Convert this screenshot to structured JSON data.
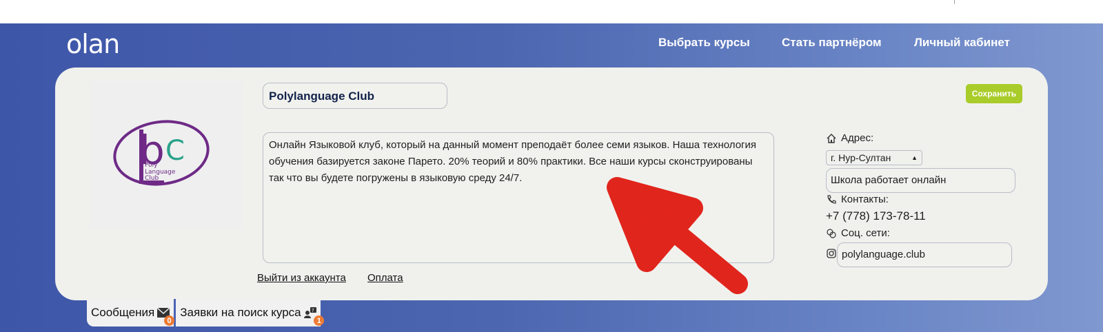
{
  "header": {
    "logo_text": "olan",
    "nav": [
      "Выбрать курсы",
      "Стать партнёром",
      "Личный кабинет"
    ]
  },
  "profile": {
    "school_name": "Polylanguage Club",
    "description": "Онлайн Языковой клуб, который на данный момент преподаёт более семи языков. Наша технология обучения базируется законе Парето. 20% теорий и 80% практики. Все наши курсы сконструированы так что вы будете погружены в языковую среду 24/7.",
    "logo_letters": "pC",
    "logo_caption": [
      "Poly",
      "Language",
      "Club"
    ],
    "save_label": "Сохранить",
    "logout_label": "Выйти из аккаунта",
    "payment_label": "Оплата"
  },
  "sidebar": {
    "address_label": "Адрес:",
    "city": "г. Нур-Султан",
    "online_text": "Школа работает онлайн",
    "contacts_label": "Контакты:",
    "phone": "+7 (778) 173-78-11",
    "social_label": "Соц. сети:",
    "instagram": "polylanguage.club"
  },
  "tabs": {
    "messages_label": "Сообщения",
    "messages_count": "0",
    "requests_label": "Заявки на поиск курса",
    "requests_count": "1"
  },
  "colors": {
    "accent": "#a9cc2a",
    "badge": "#ee7b34",
    "arrow": "#e0251c",
    "logo_purple": "#6e2a86",
    "logo_teal": "#2aa28a"
  }
}
